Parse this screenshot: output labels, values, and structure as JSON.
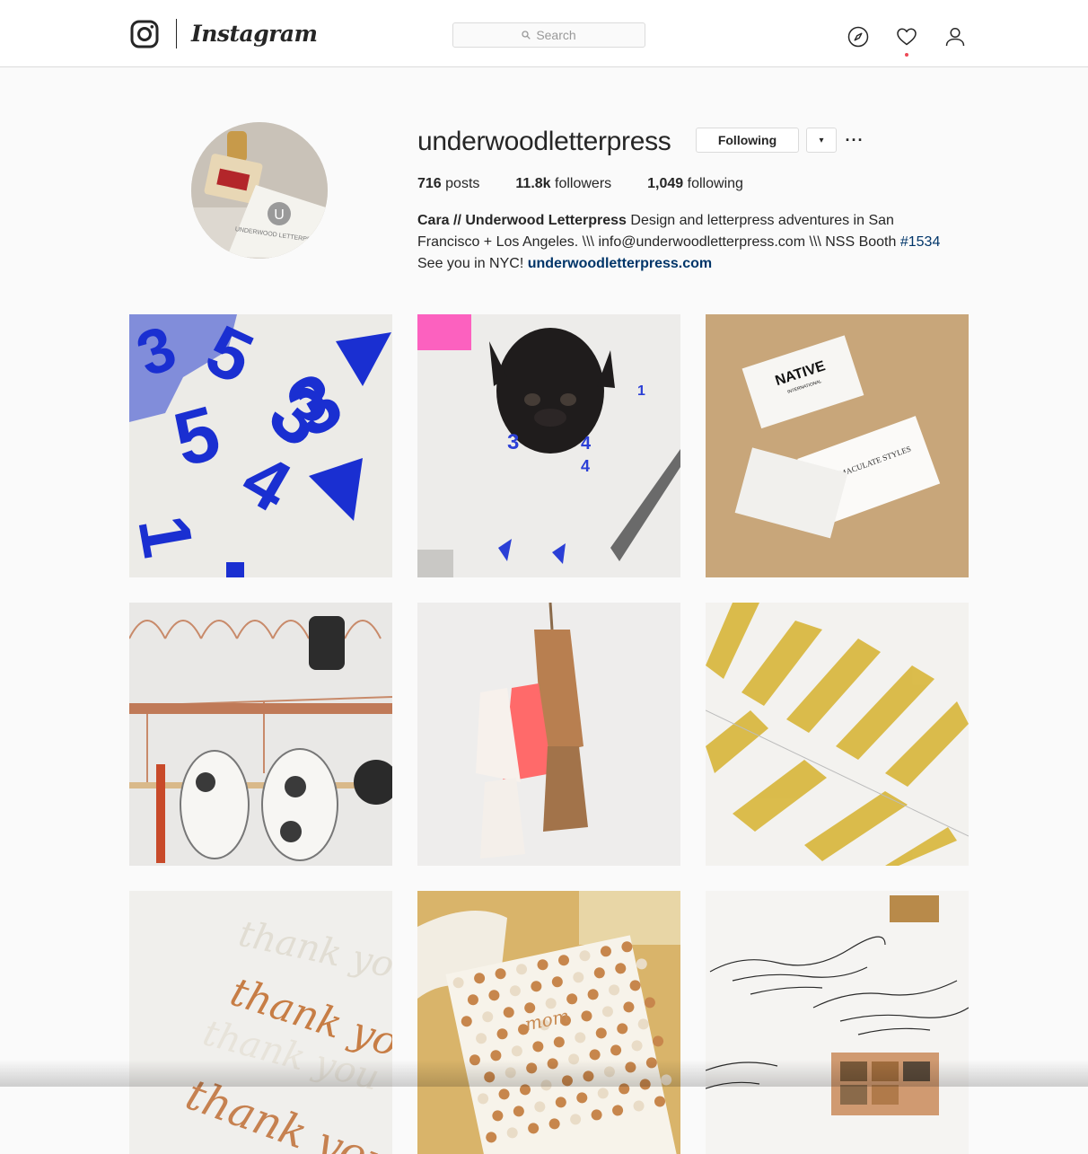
{
  "nav": {
    "wordmark": "Instagram",
    "search_placeholder": "Search",
    "icons": [
      "instagram-glyph-icon",
      "compass-icon",
      "heart-icon",
      "person-icon"
    ],
    "notification_color": "#ed4956"
  },
  "profile": {
    "username": "underwoodletterpress",
    "following_label": "Following",
    "dropdown_glyph": "▾",
    "more_glyph": "···",
    "stats": {
      "posts_count": "716",
      "posts_label": "posts",
      "followers_count": "11.8k",
      "followers_label": "followers",
      "following_count": "1,049",
      "following_label": "following"
    },
    "bio": {
      "name": "Cara // Underwood Letterpress",
      "text1": " Design and letterpress adventures in San Francisco + Los Angeles. \\\\\\ info@underwoodletterpress.com \\\\\\ NSS Booth ",
      "hashtag": "#1534",
      "text2": " See you in NYC! ",
      "website": "underwoodletterpress.com"
    },
    "avatar_stamp_text": "UNDERWOOD LETTERPRESS"
  },
  "grid": {
    "posts": [
      {
        "subject": "blue-numbers"
      },
      {
        "subject": "french-bulldog"
      },
      {
        "subject": "business-cards",
        "text_a": "NATIVE",
        "text_b": "INTERNATIONAL",
        "text_c": "IMMACULATE STYLES"
      },
      {
        "subject": "copper-shelf"
      },
      {
        "subject": "tassels"
      },
      {
        "subject": "gold-stripes"
      },
      {
        "subject": "thank-you-cards",
        "script": "thank you"
      },
      {
        "subject": "mom-card",
        "script": "mom"
      },
      {
        "subject": "calligraphy-envelopes"
      }
    ]
  },
  "colors": {
    "link": "#003569",
    "border": "#dbdbdb",
    "background": "#fafafa",
    "text": "#262626"
  }
}
